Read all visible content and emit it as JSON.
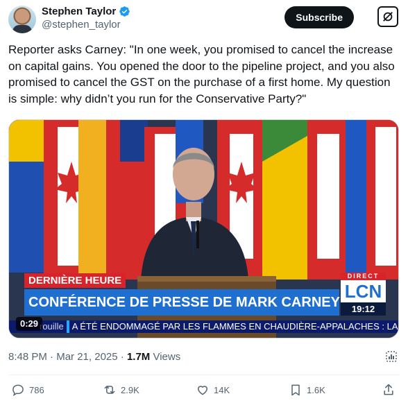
{
  "author": {
    "name": "Stephen Taylor",
    "handle": "@stephen_taylor"
  },
  "header": {
    "subscribe_label": "Subscribe"
  },
  "tweet": {
    "text": "Reporter asks Carney: \"In one week, you promised to cancel the increase on capital gains. You opened the door to the pipeline project, and you also promised to cancel the GST on the purchase of a first home. My question is simple: why didn’t you run for the Conservative Party?\""
  },
  "video": {
    "breaking_label": "DERNIÈRE HEURE",
    "headline": "CONFÉRENCE DE PRESSE DE MARK CARNEY",
    "network_direct": "DIRECT",
    "network_logo": "LCN",
    "network_time": "19:12",
    "ticker_lead": "rouille",
    "ticker_text": "A ÉTÉ ENDOMMAGÉ PAR LES FLAMMES EN CHAUDIÈRE-APPALACHES : LA",
    "duration": "0:29"
  },
  "meta": {
    "time": "8:48 PM",
    "separator": "·",
    "date": "Mar 21, 2025",
    "views_count": "1.7M",
    "views_label": "Views"
  },
  "actions": {
    "replies": "786",
    "reposts": "2.9K",
    "likes": "14K",
    "bookmarks": "1.6K"
  },
  "colors": {
    "verified": "#1d9bf0",
    "breaking_red": "#d8232a",
    "headline_blue": "#1f6fd1",
    "ticker_navy": "#0c1a6b"
  },
  "icons": [
    "verified-badge-icon",
    "grok-icon",
    "more-icon",
    "reply-icon",
    "repost-icon",
    "like-icon",
    "bookmark-icon",
    "share-icon",
    "analytics-icon"
  ]
}
